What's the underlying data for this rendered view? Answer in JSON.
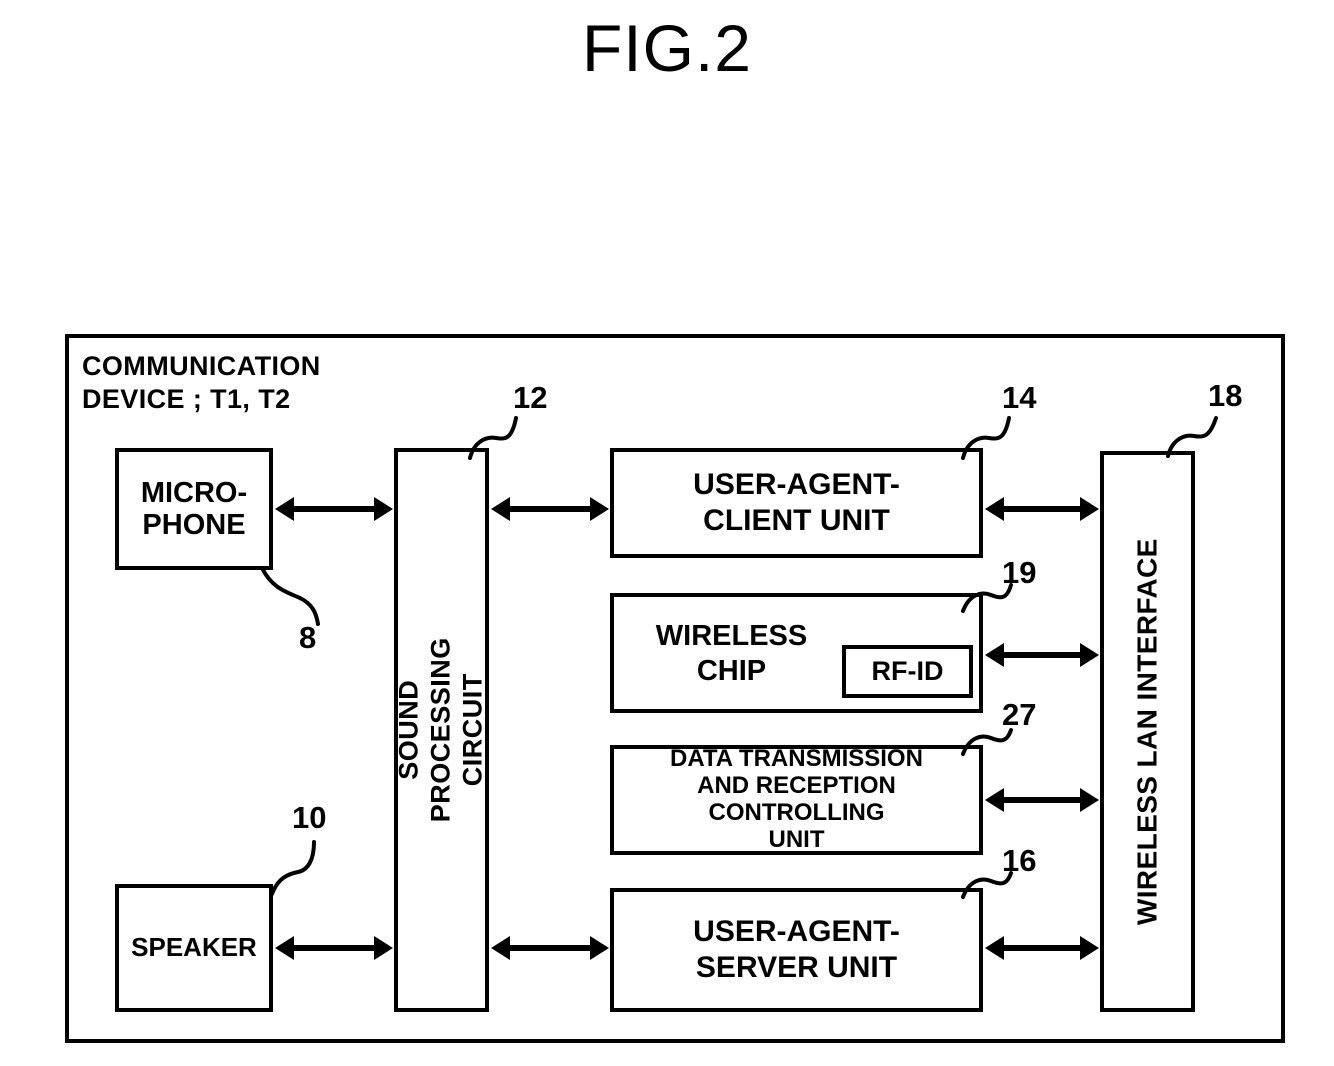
{
  "figure": {
    "title": "FIG.2",
    "device_caption": "COMMUNICATION\nDEVICE ; T1, T2"
  },
  "blocks": [
    {
      "id": "microphone",
      "label": "MICRO-\nPHONE",
      "ref": "8"
    },
    {
      "id": "speaker",
      "label": "SPEAKER",
      "ref": "10"
    },
    {
      "id": "sound_circuit",
      "label": "SOUND PROCESSING\nCIRCUIT",
      "ref": "12"
    },
    {
      "id": "uac",
      "label": "USER-AGENT-\nCLIENT UNIT",
      "ref": "14"
    },
    {
      "id": "wireless_chip",
      "label": "WIRELESS\nCHIP",
      "ref": "19"
    },
    {
      "id": "rfid",
      "label": "RF-ID",
      "ref": ""
    },
    {
      "id": "data_ctrl",
      "label": "DATA TRANSMISSION\nAND RECEPTION\nCONTROLLING\nUNIT",
      "ref": "27"
    },
    {
      "id": "uas",
      "label": "USER-AGENT-\nSERVER UNIT",
      "ref": "16"
    },
    {
      "id": "wlan",
      "label": "WIRELESS LAN INTERFACE",
      "ref": "18"
    }
  ],
  "reference_numerals": {
    "microphone": "8",
    "speaker": "10",
    "sound_circuit": "12",
    "uac": "14",
    "uas": "16",
    "wlan": "18",
    "wireless_chip": "19",
    "data_ctrl": "27"
  },
  "connections": [
    {
      "from": "microphone",
      "to": "sound_circuit",
      "type": "bidirectional"
    },
    {
      "from": "speaker",
      "to": "sound_circuit",
      "type": "bidirectional"
    },
    {
      "from": "sound_circuit",
      "to": "uac",
      "type": "bidirectional"
    },
    {
      "from": "sound_circuit",
      "to": "uas",
      "type": "bidirectional"
    },
    {
      "from": "uac",
      "to": "wlan",
      "type": "bidirectional"
    },
    {
      "from": "wireless_chip",
      "to": "wlan",
      "type": "bidirectional"
    },
    {
      "from": "data_ctrl",
      "to": "wlan",
      "type": "bidirectional"
    },
    {
      "from": "uas",
      "to": "wlan",
      "type": "bidirectional"
    }
  ],
  "colors": {
    "ink": "#000000",
    "paper": "#ffffff"
  }
}
